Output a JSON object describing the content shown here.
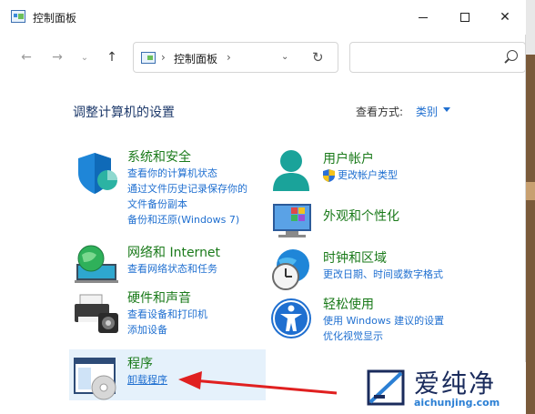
{
  "window": {
    "title": "控制面板"
  },
  "navigation": {
    "address_path": "控制面板",
    "separator": "›",
    "search_placeholder": ""
  },
  "header": {
    "title": "调整计算机的设置",
    "view_by_label": "查看方式:",
    "view_by_value": "类别"
  },
  "categories": [
    {
      "title": "系统和安全",
      "icon": "shield-icon",
      "links": [
        "查看你的计算机状态",
        "通过文件历史记录保存你的",
        "文件备份副本",
        "备份和还原(Windows 7)"
      ]
    },
    {
      "title": "网络和 Internet",
      "icon": "network-icon",
      "links": [
        "查看网络状态和任务"
      ]
    },
    {
      "title": "硬件和声音",
      "icon": "printer-icon",
      "links": [
        "查看设备和打印机",
        "添加设备"
      ]
    },
    {
      "title": "程序",
      "icon": "programs-icon",
      "links": [
        "卸载程序"
      ]
    },
    {
      "title": "用户帐户",
      "icon": "user-icon",
      "links": [
        "更改帐户类型"
      ]
    },
    {
      "title": "外观和个性化",
      "icon": "appearance-icon",
      "links": []
    },
    {
      "title": "时钟和区域",
      "icon": "clock-icon",
      "links": [
        "更改日期、时间或数字格式"
      ]
    },
    {
      "title": "轻松使用",
      "icon": "accessibility-icon",
      "links": [
        "使用 Windows 建议的设置",
        "优化视觉显示"
      ]
    }
  ],
  "watermark": {
    "brand": "爱纯净",
    "url": "aichunjing.com"
  },
  "colors": {
    "category_title": "#1a7a1a",
    "link": "#1f6fd0",
    "header": "#1e3a6b",
    "highlight": "#e5f1fb",
    "annotation_arrow": "#e02020"
  }
}
